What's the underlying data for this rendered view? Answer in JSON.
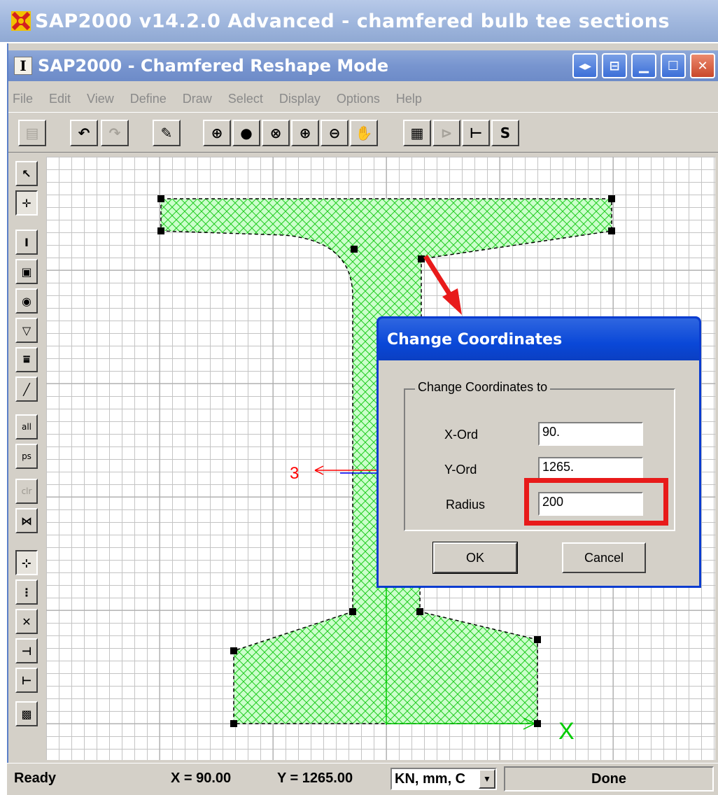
{
  "app_title": "SAP2000 v14.2.0 Advanced  - chamfered bulb tee sections",
  "window_title": "SAP2000 - Chamfered  Reshape Mode",
  "menu": [
    "File",
    "Edit",
    "View",
    "Define",
    "Draw",
    "Select",
    "Display",
    "Options",
    "Help"
  ],
  "toolbar": {
    "icons": [
      "new-icon",
      "undo-icon",
      "redo-icon",
      "pencil-icon",
      "zoom-window-icon",
      "zoom-restore-icon",
      "zoom-previous-icon",
      "zoom-in-icon",
      "zoom-out-icon",
      "pan-icon",
      "table-icon",
      "axis-icon",
      "sap-section-icon"
    ],
    "s_label": "S"
  },
  "left_toolbar": {
    "icons": [
      "pointer-icon",
      "reshape-pointer-icon",
      "draw-i-section-icon",
      "draw-rectangle-icon",
      "draw-circle-icon",
      "draw-polygon-icon",
      "draw-rebar-icon",
      "draw-line-icon",
      "select-all-icon",
      "select-previous-icon",
      "clear-selection-icon",
      "snap-grid-icon",
      "snap-point-icon",
      "snap-midpoint-icon",
      "snap-intersection-icon",
      "snap-perpendicular-icon",
      "snap-end-icon",
      "snap-grid-box-icon"
    ],
    "all_label": "all",
    "ps_label": "ps",
    "clr_label": "clr"
  },
  "canvas": {
    "axis_label_3": "3",
    "axis_label_x": "X",
    "fill_color": "#00ff00"
  },
  "dialog": {
    "title": "Change Coordinates",
    "group_title": "Change Coordinates to",
    "x_label": "X-Ord",
    "x_value": "90.",
    "y_label": "Y-Ord",
    "y_value": "1265.",
    "radius_label": "Radius",
    "radius_value": "200",
    "ok_label": "OK",
    "cancel_label": "Cancel"
  },
  "status": {
    "ready": "Ready",
    "x_coord": "X = 90.00",
    "y_coord": "Y = 1265.00",
    "units": "KN, mm, C",
    "done": "Done"
  },
  "colors": {
    "highlight": "#e81a1a",
    "arrow": "#e81a1a",
    "dialog_title": "#0a48d8"
  }
}
